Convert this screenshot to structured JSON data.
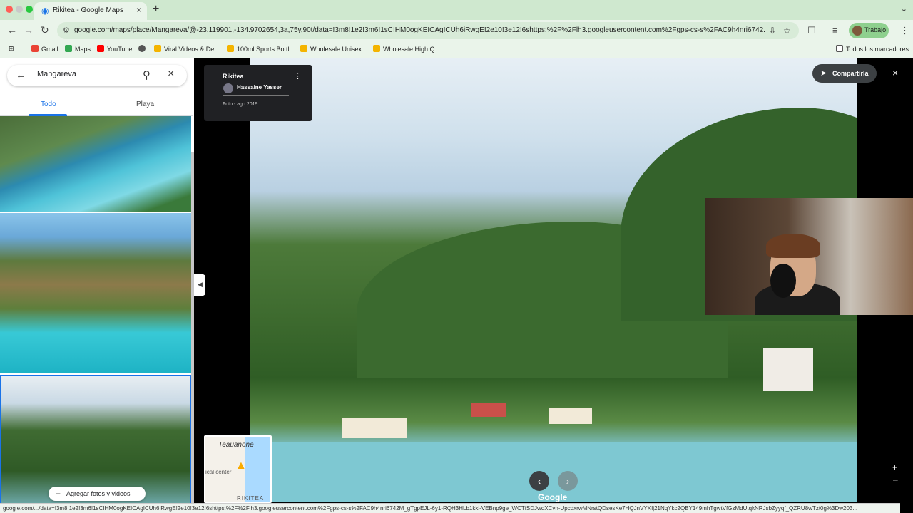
{
  "browser": {
    "tab": {
      "title": "Rikitea - Google Maps"
    },
    "url": "google.com/maps/place/Mangareva/@-23.119901,-134.9702654,3a,75y,90t/data=!3m8!1e2!3m6!1sCIHM0ogKEICAgICUh6iRwgE!2e10!3e12!6shttps:%2F%2Flh3.googleusercontent.com%2Fgps-cs-s%2FAC9h4nri6742...",
    "profile": "Trabajo",
    "bookmarks": [
      {
        "label": "Gmail",
        "icon": "gmail-icon"
      },
      {
        "label": "Maps",
        "icon": "maps-pin-icon"
      },
      {
        "label": "YouTube",
        "icon": "youtube-icon"
      },
      {
        "label": "",
        "icon": "globe-icon"
      },
      {
        "label": "Viral Videos & De...",
        "icon": "bookmark-icon"
      },
      {
        "label": "100ml Sports Bottl...",
        "icon": "bookmark-icon"
      },
      {
        "label": "Wholesale Unisex...",
        "icon": "bookmark-icon"
      },
      {
        "label": "Wholesale High Q...",
        "icon": "bookmark-icon"
      }
    ],
    "all_bookmarks": "Todos los marcadores"
  },
  "sidebar": {
    "search_value": "Mangareva",
    "tabs": [
      {
        "label": "Todo",
        "active": true
      },
      {
        "label": "Playa",
        "active": false
      }
    ],
    "add_photos": "Agregar fotos y videos"
  },
  "photo_info": {
    "title": "Rikitea",
    "author": "Hassaine Yasser",
    "date": "Foto - ago 2019"
  },
  "viewer": {
    "share": "Compartirla",
    "logo": "Google"
  },
  "minimap": {
    "title": "Teauanone",
    "label": "ical center",
    "bottom": "RIKITEA"
  },
  "status": "google.com/.../data=!3m8!1e2!3m6!1sCIHM0ogKEICAgICUh6iRwgE!2e10!3e12!6shttps:%2F%2Flh3.googleusercontent.com%2Fgps-cs-s%2FAC9h4nri6742M_gTgpEJL-6y1-RQH3HLb1kkl-VEBnp9ge_WCTfSDJwdXCvn-UpcdxrwMNrstQDsesKe7HQJnVYKIj21NqYkc2QBY149mhTgwtVfGzMdUtqkNRJsbZyyqf_QZRU8wTzt0g%3Dw203...",
  "colors": {
    "accent": "#1a73e8",
    "chrome": "#cfe8cf"
  }
}
